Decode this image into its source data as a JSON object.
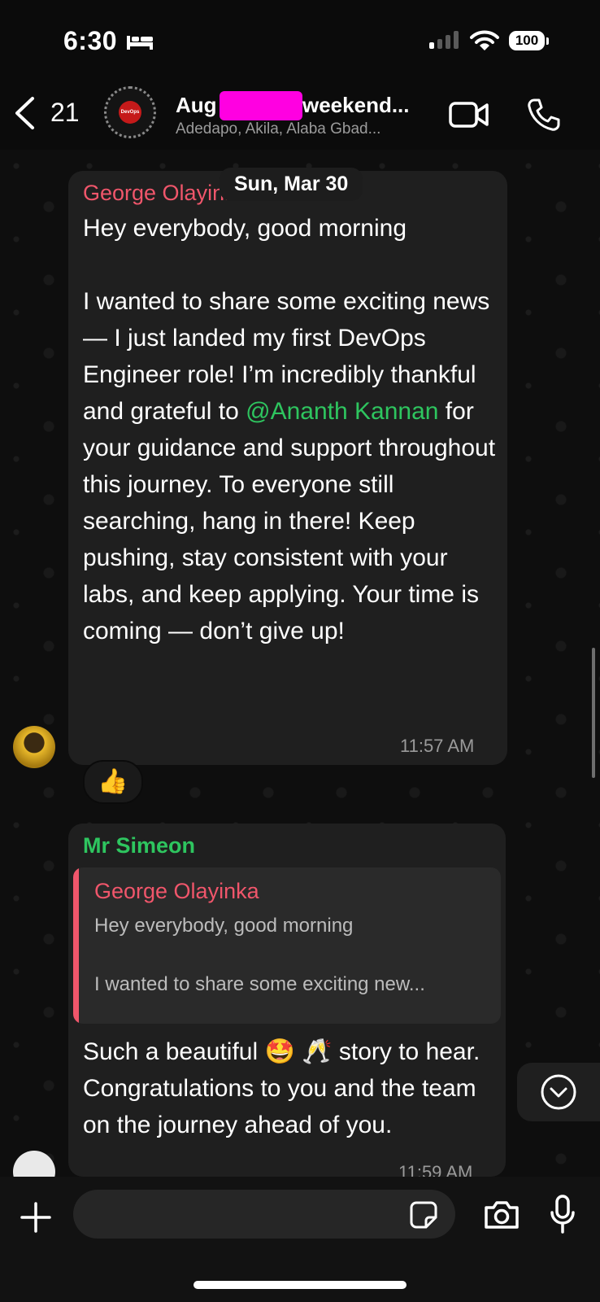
{
  "status_bar": {
    "time": "6:30",
    "battery": "100"
  },
  "header": {
    "back_count": "21",
    "group_name_start": "Aug",
    "group_name_end": "weekend...",
    "members": "Adedapo, Akila, Alaba Gbad...",
    "avatar_text": "DevOps"
  },
  "chat": {
    "date_label": "Sun, Mar 30",
    "messages": [
      {
        "sender": "George  Olayinka",
        "text_before_mention": "Hey everybody, good morning\n\nI wanted to share some exciting news — I just landed my first DevOps Engineer role! I’m incredibly thankful and grateful to ",
        "mention": "@Ananth Kannan",
        "text_after_mention": " for your guidance and support throughout this journey. To everyone still searching, hang in there! Keep pushing, stay consistent with your labs, and keep applying. Your time is coming — don’t give up!",
        "time": "11:57 AM",
        "reaction": "👍"
      },
      {
        "sender": "Mr Simeon",
        "quote": {
          "sender": "George  Olayinka",
          "line1": "Hey everybody, good morning",
          "line2": "I wanted to share some exciting new..."
        },
        "text": "Such a beautiful 🤩 🥂 story to hear. Congratulations to you and the team on the journey ahead of you.",
        "time": "11:59 AM"
      }
    ]
  },
  "composer": {
    "placeholder": ""
  },
  "colors": {
    "mention": "#2ec55f",
    "sender_red": "#f0566b",
    "redaction": "#ff00e1"
  },
  "icons": [
    "bed-icon",
    "wifi-icon",
    "back-icon",
    "video-icon",
    "call-icon",
    "plus-icon",
    "sticker-icon",
    "camera-icon",
    "mic-icon",
    "chevron-down-icon"
  ]
}
